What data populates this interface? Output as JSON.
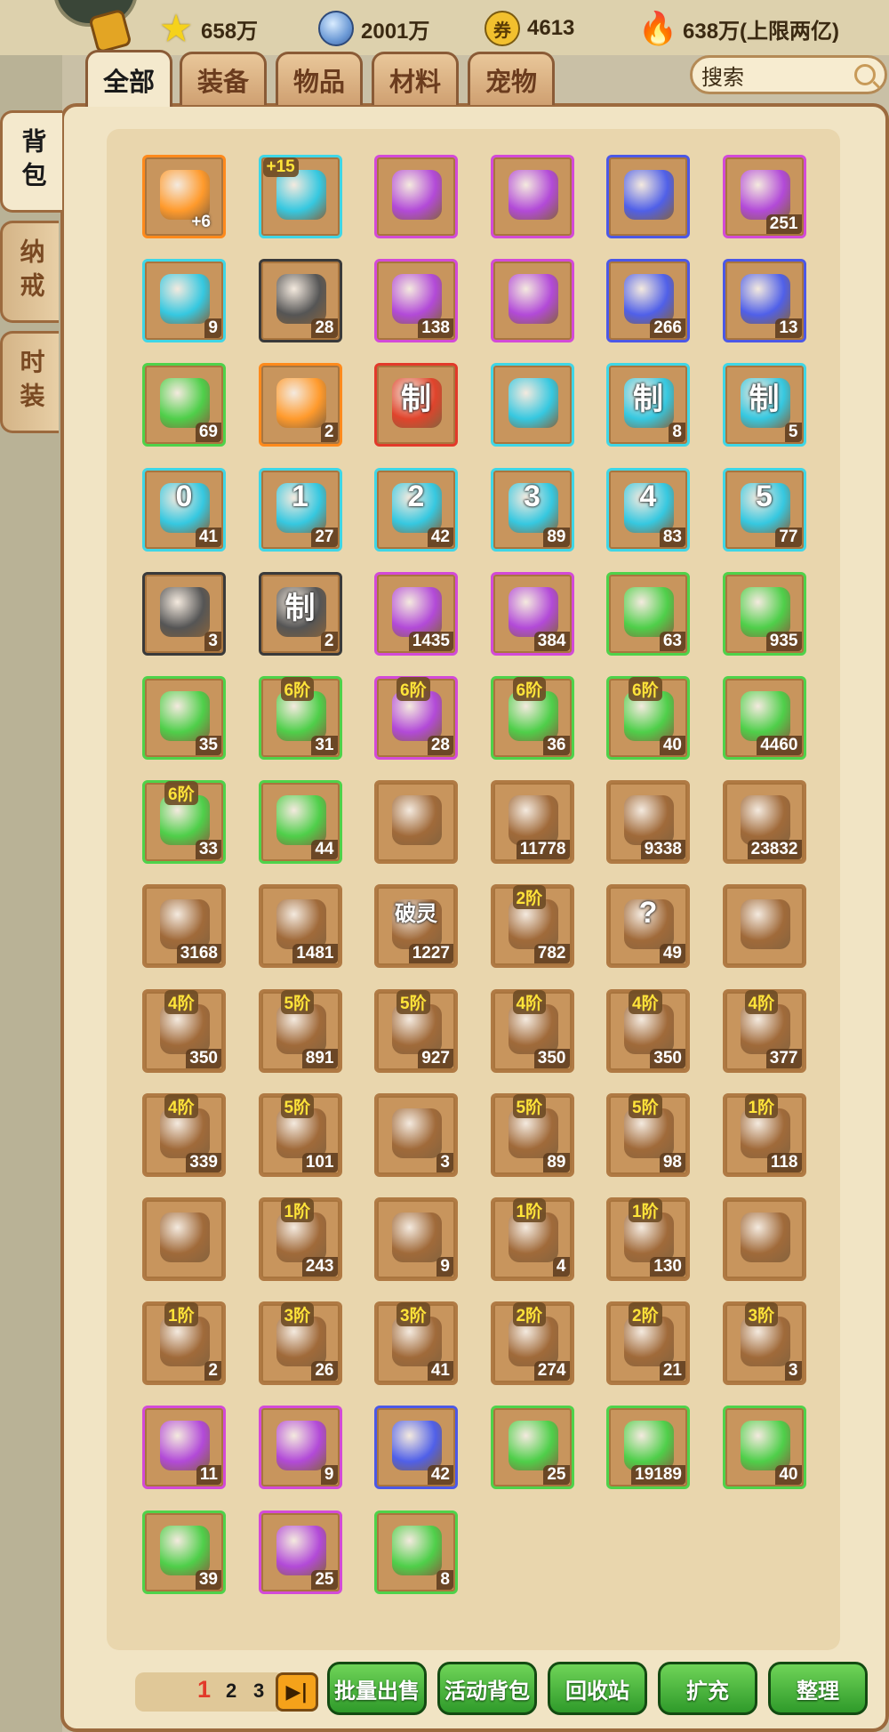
{
  "resources": {
    "stars": "658万",
    "coins": "2001万",
    "tickets": "4613",
    "tickets_glyph": "券",
    "spirit": "638万(上限两亿)"
  },
  "tabs": [
    "全部",
    "装备",
    "物品",
    "材料",
    "宠物"
  ],
  "active_tab": "全部",
  "search": {
    "value": "搜索"
  },
  "side_tabs": [
    "背包",
    "纳戒",
    "时装"
  ],
  "active_side_tab": "背包",
  "rarity_colors": {
    "orange": "#ff8a1c",
    "cyan": "#3fd6e6",
    "purple": "#d34ad8",
    "blue": "#4c58e6",
    "green": "#4fd24a",
    "dark": "#3a3a3a",
    "red": "#e23a2a"
  },
  "items": [
    {
      "icon": "helmet-icon",
      "rarity": "orange",
      "qty": "",
      "plus": "+6",
      "tier": "",
      "glyph": ""
    },
    {
      "icon": "armor-icon",
      "rarity": "cyan",
      "qty": "",
      "plus": "+15",
      "tier": "",
      "glyph": ""
    },
    {
      "icon": "purple-crystal-icon",
      "rarity": "purple",
      "qty": "",
      "plus": "",
      "tier": "",
      "glyph": ""
    },
    {
      "icon": "energy-orb-icon",
      "rarity": "purple",
      "qty": "",
      "plus": "",
      "tier": "",
      "glyph": ""
    },
    {
      "icon": "gold-ore-icon",
      "rarity": "blue",
      "qty": "",
      "plus": "",
      "tier": "",
      "glyph": ""
    },
    {
      "icon": "treasure-chest-icon",
      "rarity": "purple",
      "qty": "251",
      "plus": "",
      "tier": "",
      "glyph": ""
    },
    {
      "icon": "blue-gem-icon",
      "rarity": "cyan",
      "qty": "9",
      "plus": "",
      "tier": "",
      "glyph": ""
    },
    {
      "icon": "green-gem-icon",
      "rarity": "dark",
      "qty": "28",
      "plus": "",
      "tier": "",
      "glyph": ""
    },
    {
      "icon": "orange-gem-icon",
      "rarity": "purple",
      "qty": "138",
      "plus": "",
      "tier": "",
      "glyph": ""
    },
    {
      "icon": "crown-orb-icon",
      "rarity": "purple",
      "qty": "",
      "plus": "",
      "tier": "",
      "glyph": ""
    },
    {
      "icon": "pink-gem-icon",
      "rarity": "blue",
      "qty": "266",
      "plus": "",
      "tier": "",
      "glyph": ""
    },
    {
      "icon": "ruby-gem-icon",
      "rarity": "blue",
      "qty": "13",
      "plus": "",
      "tier": "",
      "glyph": ""
    },
    {
      "icon": "ice-crystal-icon",
      "rarity": "green",
      "qty": "69",
      "plus": "",
      "tier": "",
      "glyph": ""
    },
    {
      "icon": "swirl-orb-icon",
      "rarity": "orange",
      "qty": "2",
      "plus": "",
      "tier": "",
      "glyph": ""
    },
    {
      "icon": "craft-scroll-icon",
      "rarity": "red",
      "qty": "",
      "plus": "",
      "tier": "",
      "glyph": "制"
    },
    {
      "icon": "amulet-icon",
      "rarity": "cyan",
      "qty": "",
      "plus": "",
      "tier": "",
      "glyph": ""
    },
    {
      "icon": "puzzle-piece-icon",
      "rarity": "cyan",
      "qty": "8",
      "plus": "",
      "tier": "",
      "glyph": "制"
    },
    {
      "icon": "puzzle-piece-icon",
      "rarity": "cyan",
      "qty": "5",
      "plus": "",
      "tier": "",
      "glyph": "制"
    },
    {
      "icon": "orb-0-icon",
      "rarity": "cyan",
      "qty": "41",
      "plus": "",
      "tier": "",
      "glyph": "0"
    },
    {
      "icon": "orb-1-icon",
      "rarity": "cyan",
      "qty": "27",
      "plus": "",
      "tier": "",
      "glyph": "1"
    },
    {
      "icon": "orb-2-icon",
      "rarity": "cyan",
      "qty": "42",
      "plus": "",
      "tier": "",
      "glyph": "2"
    },
    {
      "icon": "orb-3-icon",
      "rarity": "cyan",
      "qty": "89",
      "plus": "",
      "tier": "",
      "glyph": "3"
    },
    {
      "icon": "orb-4-icon",
      "rarity": "cyan",
      "qty": "83",
      "plus": "",
      "tier": "",
      "glyph": "4"
    },
    {
      "icon": "orb-5-icon",
      "rarity": "cyan",
      "qty": "77",
      "plus": "",
      "tier": "",
      "glyph": "5"
    },
    {
      "icon": "wing-feather-icon",
      "rarity": "dark",
      "qty": "3",
      "plus": "",
      "tier": "",
      "glyph": ""
    },
    {
      "icon": "craft-scroll-icon",
      "rarity": "dark",
      "qty": "2",
      "plus": "",
      "tier": "",
      "glyph": "制"
    },
    {
      "icon": "water-drop-icon",
      "rarity": "purple",
      "qty": "1435",
      "plus": "",
      "tier": "",
      "glyph": ""
    },
    {
      "icon": "golden-helm-icon",
      "rarity": "purple",
      "qty": "384",
      "plus": "",
      "tier": "",
      "glyph": ""
    },
    {
      "icon": "compass-icon",
      "rarity": "green",
      "qty": "63",
      "plus": "",
      "tier": "",
      "glyph": ""
    },
    {
      "icon": "wood-log-icon",
      "rarity": "green",
      "qty": "935",
      "plus": "",
      "tier": "",
      "glyph": ""
    },
    {
      "icon": "purple-stone-icon",
      "rarity": "green",
      "qty": "35",
      "plus": "",
      "tier": "",
      "glyph": ""
    },
    {
      "icon": "silver-crystal-icon",
      "rarity": "green",
      "qty": "31",
      "plus": "",
      "tier": "6阶",
      "glyph": ""
    },
    {
      "icon": "purple-crystal-icon",
      "rarity": "purple",
      "qty": "28",
      "plus": "",
      "tier": "6阶",
      "glyph": ""
    },
    {
      "icon": "red-crystal-icon",
      "rarity": "green",
      "qty": "36",
      "plus": "",
      "tier": "6阶",
      "glyph": ""
    },
    {
      "icon": "fire-crystal-icon",
      "rarity": "green",
      "qty": "40",
      "plus": "",
      "tier": "6阶",
      "glyph": ""
    },
    {
      "icon": "amber-crystal-icon",
      "rarity": "green",
      "qty": "4460",
      "plus": "",
      "tier": "",
      "glyph": ""
    },
    {
      "icon": "blue-crystal-icon",
      "rarity": "green",
      "qty": "33",
      "plus": "",
      "tier": "6阶",
      "glyph": ""
    },
    {
      "icon": "red-banner-icon",
      "rarity": "green",
      "qty": "44",
      "plus": "",
      "tier": "",
      "glyph": ""
    },
    {
      "icon": "mask-badge-icon",
      "rarity": "none",
      "qty": "",
      "plus": "",
      "tier": "",
      "glyph": ""
    },
    {
      "icon": "cloth-roll-icon",
      "rarity": "none",
      "qty": "11778",
      "plus": "",
      "tier": "",
      "glyph": ""
    },
    {
      "icon": "logs-icon",
      "rarity": "none",
      "qty": "9338",
      "plus": "",
      "tier": "",
      "glyph": ""
    },
    {
      "icon": "iron-ingot-icon",
      "rarity": "none",
      "qty": "23832",
      "plus": "",
      "tier": "",
      "glyph": ""
    },
    {
      "icon": "paper-scroll-icon",
      "rarity": "none",
      "qty": "3168",
      "plus": "",
      "tier": "",
      "glyph": ""
    },
    {
      "icon": "ticket-icon",
      "rarity": "none",
      "qty": "1481",
      "plus": "",
      "tier": "",
      "glyph": ""
    },
    {
      "icon": "talisman-icon",
      "rarity": "none",
      "qty": "1227",
      "plus": "",
      "tier": "",
      "glyph": "破灵"
    },
    {
      "icon": "fire-crystal-icon",
      "rarity": "none",
      "qty": "782",
      "plus": "",
      "tier": "2阶",
      "glyph": ""
    },
    {
      "icon": "mystery-box-icon",
      "rarity": "none",
      "qty": "49",
      "plus": "",
      "tier": "",
      "glyph": "?"
    },
    {
      "icon": "golden-emblem-icon",
      "rarity": "none",
      "qty": "",
      "plus": "",
      "tier": "",
      "glyph": ""
    },
    {
      "icon": "blue-crystal-icon",
      "rarity": "none",
      "qty": "350",
      "plus": "",
      "tier": "4阶",
      "glyph": ""
    },
    {
      "icon": "purple-crystal-icon",
      "rarity": "none",
      "qty": "891",
      "plus": "",
      "tier": "5阶",
      "glyph": ""
    },
    {
      "icon": "fire-crystal-icon",
      "rarity": "none",
      "qty": "927",
      "plus": "",
      "tier": "5阶",
      "glyph": ""
    },
    {
      "icon": "red-crystal-icon",
      "rarity": "none",
      "qty": "350",
      "plus": "",
      "tier": "4阶",
      "glyph": ""
    },
    {
      "icon": "fire-crystal-icon",
      "rarity": "none",
      "qty": "350",
      "plus": "",
      "tier": "4阶",
      "glyph": ""
    },
    {
      "icon": "silver-crystal-icon",
      "rarity": "none",
      "qty": "377",
      "plus": "",
      "tier": "4阶",
      "glyph": ""
    },
    {
      "icon": "purple-crystal-icon",
      "rarity": "none",
      "qty": "339",
      "plus": "",
      "tier": "4阶",
      "glyph": ""
    },
    {
      "icon": "silver-crystal-icon",
      "rarity": "none",
      "qty": "101",
      "plus": "",
      "tier": "5阶",
      "glyph": ""
    },
    {
      "icon": "purple-badge-icon",
      "rarity": "none",
      "qty": "3",
      "plus": "",
      "tier": "",
      "glyph": ""
    },
    {
      "icon": "blue-crystal-icon",
      "rarity": "none",
      "qty": "89",
      "plus": "",
      "tier": "5阶",
      "glyph": ""
    },
    {
      "icon": "red-crystal-icon",
      "rarity": "none",
      "qty": "98",
      "plus": "",
      "tier": "5阶",
      "glyph": ""
    },
    {
      "icon": "silver-crystal-icon",
      "rarity": "none",
      "qty": "118",
      "plus": "",
      "tier": "1阶",
      "glyph": ""
    },
    {
      "icon": "vortex-icon",
      "rarity": "none",
      "qty": "",
      "plus": "",
      "tier": "",
      "glyph": ""
    },
    {
      "icon": "fire-crystal-icon",
      "rarity": "none",
      "qty": "243",
      "plus": "",
      "tier": "1阶",
      "glyph": ""
    },
    {
      "icon": "jade-icon",
      "rarity": "none",
      "qty": "9",
      "plus": "",
      "tier": "",
      "glyph": ""
    },
    {
      "icon": "blue-crystal-icon",
      "rarity": "none",
      "qty": "4",
      "plus": "",
      "tier": "1阶",
      "glyph": ""
    },
    {
      "icon": "purple-crystal-icon",
      "rarity": "none",
      "qty": "130",
      "plus": "",
      "tier": "1阶",
      "glyph": ""
    },
    {
      "icon": "red-emblem-icon",
      "rarity": "none",
      "qty": "",
      "plus": "",
      "tier": "",
      "glyph": ""
    },
    {
      "icon": "red-crystal-icon",
      "rarity": "none",
      "qty": "2",
      "plus": "",
      "tier": "1阶",
      "glyph": ""
    },
    {
      "icon": "silver-crystal-icon",
      "rarity": "none",
      "qty": "26",
      "plus": "",
      "tier": "3阶",
      "glyph": ""
    },
    {
      "icon": "purple-crystal-icon",
      "rarity": "none",
      "qty": "41",
      "plus": "",
      "tier": "3阶",
      "glyph": ""
    },
    {
      "icon": "purple-crystal-icon",
      "rarity": "none",
      "qty": "274",
      "plus": "",
      "tier": "2阶",
      "glyph": ""
    },
    {
      "icon": "silver-crystal-icon",
      "rarity": "none",
      "qty": "21",
      "plus": "",
      "tier": "2阶",
      "glyph": ""
    },
    {
      "icon": "blue-crystal-icon",
      "rarity": "none",
      "qty": "3",
      "plus": "",
      "tier": "3阶",
      "glyph": ""
    },
    {
      "icon": "green-potion-icon",
      "rarity": "purple",
      "qty": "11",
      "plus": "",
      "tier": "",
      "glyph": ""
    },
    {
      "icon": "blue-spirit-orb-icon",
      "rarity": "purple",
      "qty": "9",
      "plus": "",
      "tier": "",
      "glyph": ""
    },
    {
      "icon": "green-vial-icon",
      "rarity": "blue",
      "qty": "42",
      "plus": "",
      "tier": "",
      "glyph": ""
    },
    {
      "icon": "green-flame-icon",
      "rarity": "green",
      "qty": "25",
      "plus": "",
      "tier": "",
      "glyph": ""
    },
    {
      "icon": "exp-potion-icon",
      "rarity": "green",
      "qty": "19189",
      "plus": "",
      "tier": "",
      "glyph": ""
    },
    {
      "icon": "blue-flame-icon",
      "rarity": "green",
      "qty": "40",
      "plus": "",
      "tier": "",
      "glyph": ""
    },
    {
      "icon": "golden-flame-icon",
      "rarity": "green",
      "qty": "39",
      "plus": "",
      "tier": "",
      "glyph": ""
    },
    {
      "icon": "blue-potion-icon",
      "rarity": "purple",
      "qty": "25",
      "plus": "",
      "tier": "",
      "glyph": ""
    },
    {
      "icon": "rainbow-crystal-icon",
      "rarity": "green",
      "qty": "8",
      "plus": "",
      "tier": "",
      "glyph": ""
    }
  ],
  "pages": [
    "1",
    "2",
    "3"
  ],
  "current_page": "1",
  "buttons": {
    "batch_sell": "批量出售",
    "event_bag": "活动背包",
    "recycle": "回收站",
    "expand": "扩充",
    "sort": "整理"
  }
}
